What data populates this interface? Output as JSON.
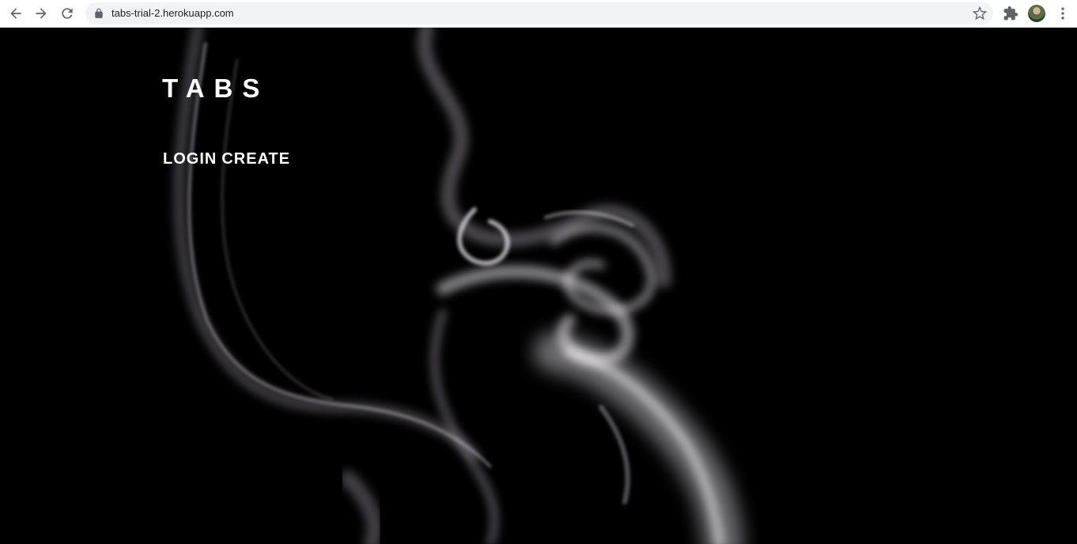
{
  "browser": {
    "url": "tabs-trial-2.herokuapp.com",
    "icons": [
      "back-arrow-icon",
      "forward-arrow-icon",
      "reload-icon",
      "lock-icon",
      "star-icon",
      "extensions-puzzle-icon",
      "profile-avatar",
      "more-menu-icon"
    ]
  },
  "page": {
    "title": "TABS",
    "nav": {
      "login": "LOGIN",
      "create": "CREATE"
    },
    "background_color": "#000000",
    "text_color": "#ffffff"
  }
}
